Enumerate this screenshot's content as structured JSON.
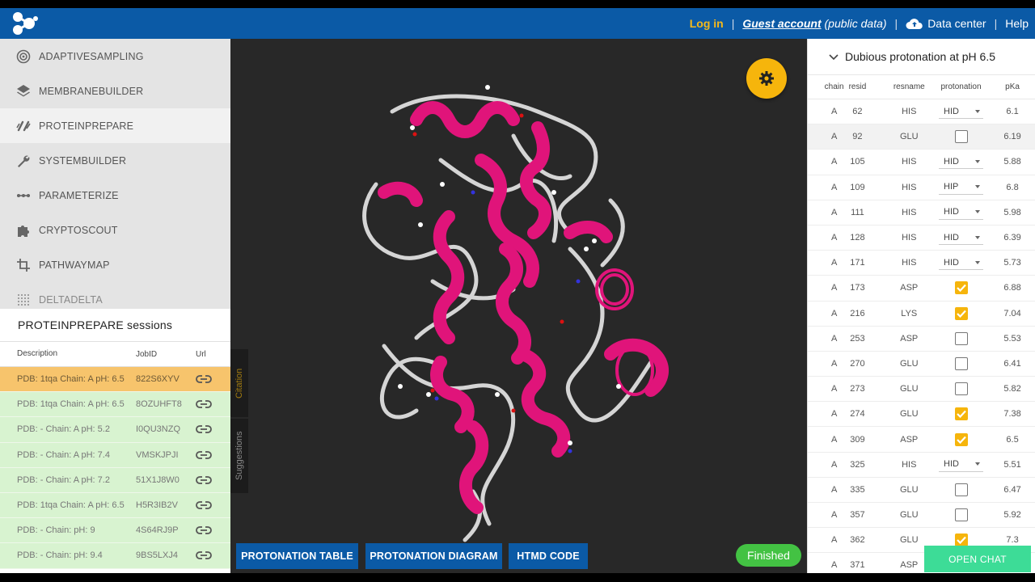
{
  "header": {
    "login": "Log in",
    "guest_account": "Guest account",
    "guest_suffix": "(public data)",
    "data_center": "Data center",
    "help": "Help",
    "bg_color": "#0b5aa6",
    "accent_color": "#f5b91a"
  },
  "sidebar": {
    "items": [
      {
        "label": "ADAPTIVESAMPLING",
        "icon": "adaptive-icon"
      },
      {
        "label": "MEMBRANEBUILDER",
        "icon": "layers-icon"
      },
      {
        "label": "PROTEINPREPARE",
        "icon": "brush-icon",
        "active": true
      },
      {
        "label": "SYSTEMBUILDER",
        "icon": "wrench-icon"
      },
      {
        "label": "PARAMETERIZE",
        "icon": "dots-line-icon"
      },
      {
        "label": "CRYPTOSCOUT",
        "icon": "puzzle-icon"
      },
      {
        "label": "PATHWAYMAP",
        "icon": "crop-icon"
      },
      {
        "label": "DELTADELTA",
        "icon": "grid-icon"
      }
    ]
  },
  "sessions": {
    "title": "PROTEINPREPARE sessions",
    "columns": {
      "desc": "Description",
      "job": "JobID",
      "url": "Url"
    },
    "rows": [
      {
        "desc": "PDB: 1tqa Chain: A pH: 6.5",
        "job": "822S6XYV",
        "selected": true
      },
      {
        "desc": "PDB: 1tqa Chain: A pH: 6.5",
        "job": "8OZUHFT8"
      },
      {
        "desc": "PDB: - Chain: A pH: 5.2",
        "job": "I0QU3NZQ"
      },
      {
        "desc": "PDB: - Chain: A pH: 7.4",
        "job": "VMSKJPJI"
      },
      {
        "desc": "PDB: - Chain: A pH: 7.2",
        "job": "51X1J8W0"
      },
      {
        "desc": "PDB: 1tqa Chain: A pH: 6.5",
        "job": "H5R3IB2V"
      },
      {
        "desc": "PDB: - Chain: pH: 9",
        "job": "4S64RJ9P"
      },
      {
        "desc": "PDB: - Chain: pH: 9.4",
        "job": "9BS5LXJ4"
      }
    ]
  },
  "viewer": {
    "citation": "Citation",
    "suggestions": "Suggestions",
    "btn_table": "PROTONATION TABLE",
    "btn_diagram": "PROTONATION DIAGRAM",
    "btn_code": "HTMD CODE",
    "status": "Finished"
  },
  "protonation": {
    "title": "Dubious protonation at pH 6.5",
    "columns": {
      "chain": "chain",
      "resid": "resid",
      "resname": "resname",
      "protonation": "protonation",
      "pka": "pKa"
    },
    "rows": [
      {
        "chain": "A",
        "resid": "62",
        "resname": "HIS",
        "type": "select",
        "value": "HID",
        "pka": "6.1"
      },
      {
        "chain": "A",
        "resid": "92",
        "resname": "GLU",
        "type": "check",
        "checked": false,
        "pka": "6.19"
      },
      {
        "chain": "A",
        "resid": "105",
        "resname": "HIS",
        "type": "select",
        "value": "HID",
        "pka": "5.88"
      },
      {
        "chain": "A",
        "resid": "109",
        "resname": "HIS",
        "type": "select",
        "value": "HIP",
        "pka": "6.8"
      },
      {
        "chain": "A",
        "resid": "111",
        "resname": "HIS",
        "type": "select",
        "value": "HID",
        "pka": "5.98"
      },
      {
        "chain": "A",
        "resid": "128",
        "resname": "HIS",
        "type": "select",
        "value": "HID",
        "pka": "6.39"
      },
      {
        "chain": "A",
        "resid": "171",
        "resname": "HIS",
        "type": "select",
        "value": "HID",
        "pka": "5.73"
      },
      {
        "chain": "A",
        "resid": "173",
        "resname": "ASP",
        "type": "check",
        "checked": true,
        "pka": "6.88"
      },
      {
        "chain": "A",
        "resid": "216",
        "resname": "LYS",
        "type": "check",
        "checked": true,
        "pka": "7.04"
      },
      {
        "chain": "A",
        "resid": "253",
        "resname": "ASP",
        "type": "check",
        "checked": false,
        "pka": "5.53"
      },
      {
        "chain": "A",
        "resid": "270",
        "resname": "GLU",
        "type": "check",
        "checked": false,
        "pka": "6.41"
      },
      {
        "chain": "A",
        "resid": "273",
        "resname": "GLU",
        "type": "check",
        "checked": false,
        "pka": "5.82"
      },
      {
        "chain": "A",
        "resid": "274",
        "resname": "GLU",
        "type": "check",
        "checked": true,
        "pka": "7.38"
      },
      {
        "chain": "A",
        "resid": "309",
        "resname": "ASP",
        "type": "check",
        "checked": true,
        "pka": "6.5"
      },
      {
        "chain": "A",
        "resid": "325",
        "resname": "HIS",
        "type": "select",
        "value": "HID",
        "pka": "5.51"
      },
      {
        "chain": "A",
        "resid": "335",
        "resname": "GLU",
        "type": "check",
        "checked": false,
        "pka": "6.47"
      },
      {
        "chain": "A",
        "resid": "357",
        "resname": "GLU",
        "type": "check",
        "checked": false,
        "pka": "5.92"
      },
      {
        "chain": "A",
        "resid": "362",
        "resname": "GLU",
        "type": "check",
        "checked": true,
        "pka": "7.3"
      },
      {
        "chain": "A",
        "resid": "371",
        "resname": "ASP",
        "type": "check",
        "checked": false,
        "pka": ""
      }
    ]
  },
  "chat": {
    "label": "OPEN CHAT"
  }
}
